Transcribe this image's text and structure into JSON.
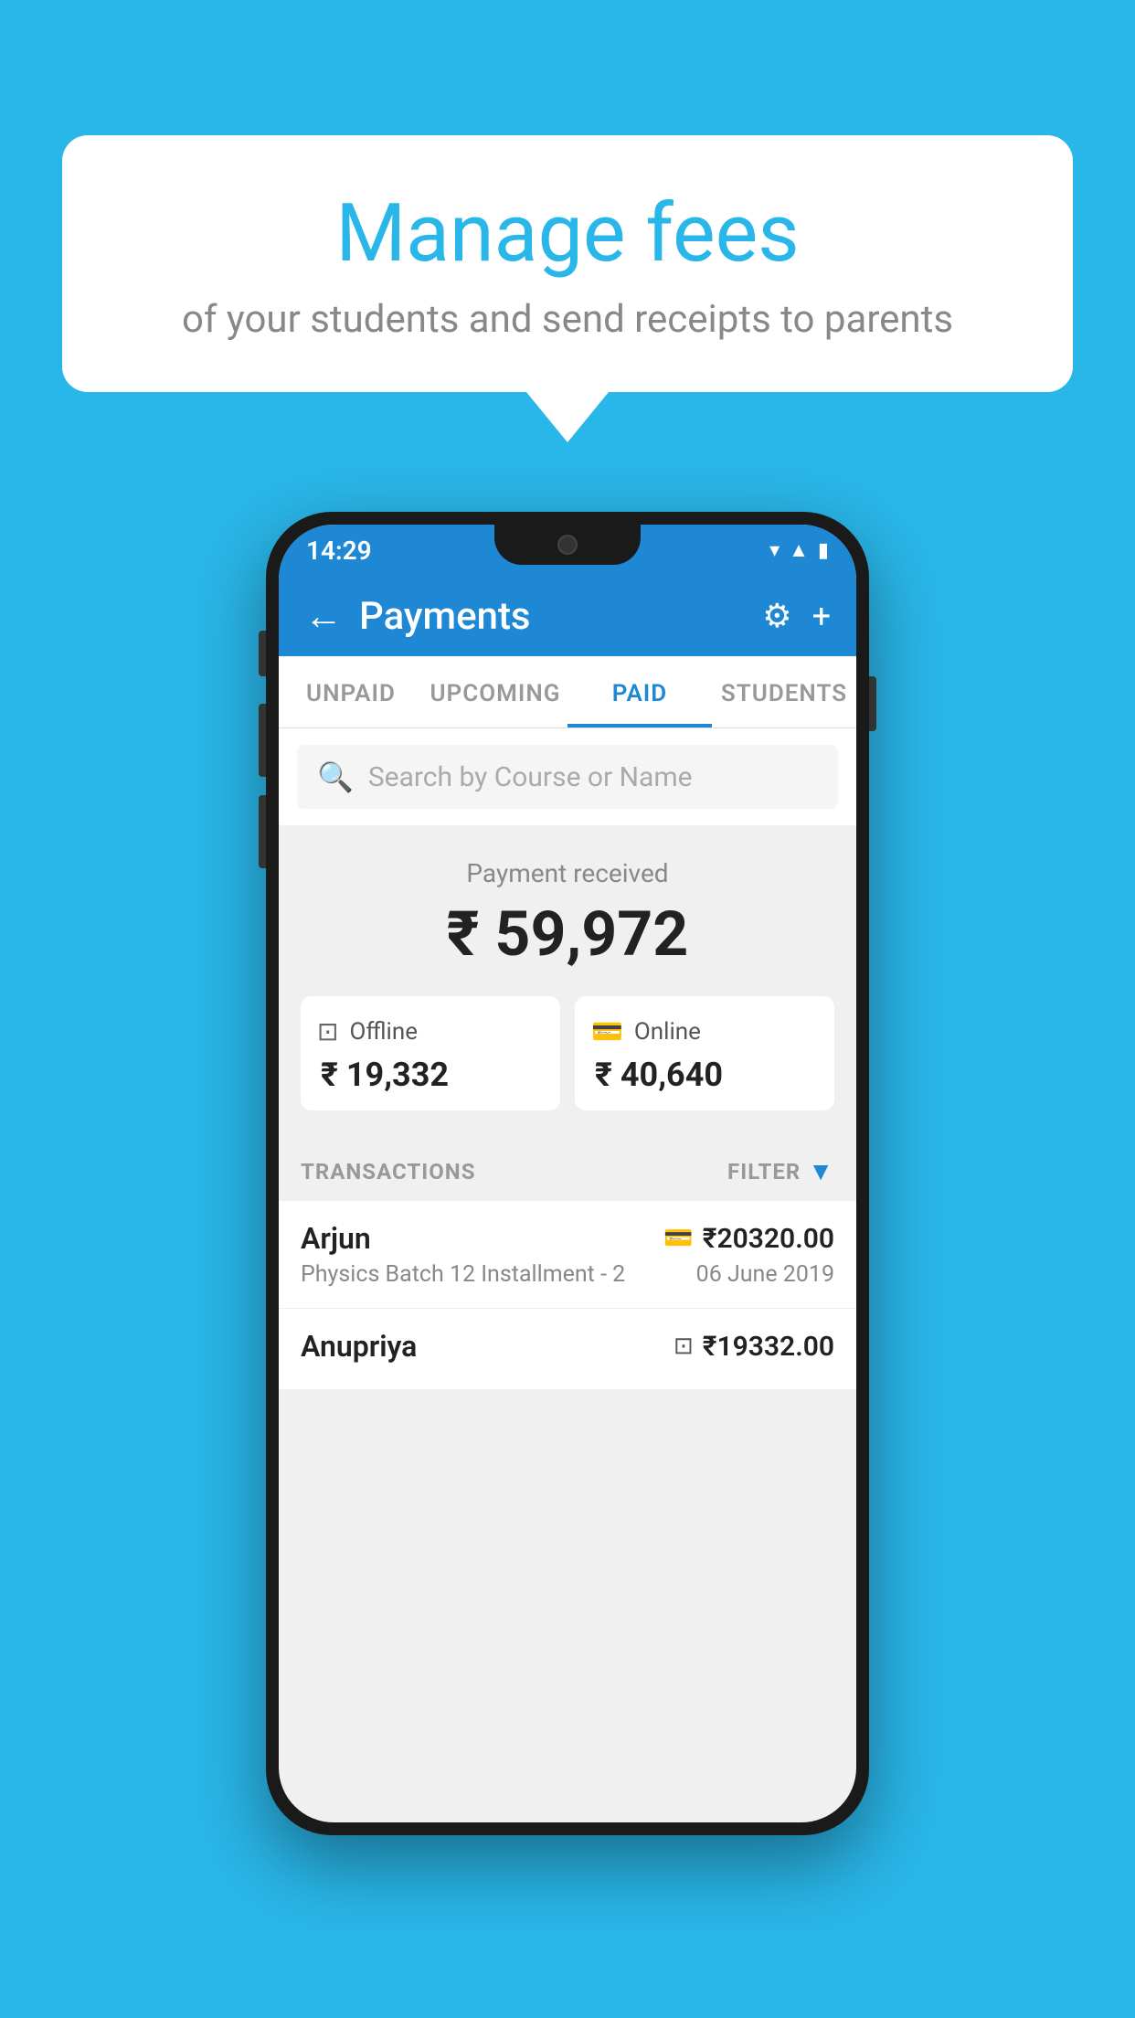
{
  "background_color": "#29b6e8",
  "speech_bubble": {
    "title": "Manage fees",
    "subtitle": "of your students and send receipts to parents"
  },
  "phone": {
    "status_bar": {
      "time": "14:29",
      "icons": [
        "wifi",
        "signal",
        "battery"
      ]
    },
    "app_bar": {
      "back_label": "←",
      "title": "Payments",
      "gear_icon": "⚙",
      "add_icon": "+"
    },
    "tabs": [
      {
        "label": "UNPAID",
        "active": false
      },
      {
        "label": "UPCOMING",
        "active": false
      },
      {
        "label": "PAID",
        "active": true
      },
      {
        "label": "STUDENTS",
        "active": false
      }
    ],
    "search": {
      "placeholder": "Search by Course or Name"
    },
    "payment_summary": {
      "label": "Payment received",
      "total": "₹ 59,972",
      "offline_label": "Offline",
      "offline_amount": "₹ 19,332",
      "online_label": "Online",
      "online_amount": "₹ 40,640"
    },
    "transactions": {
      "section_label": "TRANSACTIONS",
      "filter_label": "FILTER",
      "items": [
        {
          "name": "Arjun",
          "course": "Physics Batch 12 Installment - 2",
          "amount": "₹20320.00",
          "date": "06 June 2019",
          "method": "card"
        },
        {
          "name": "Anupriya",
          "course": "",
          "amount": "₹19332.00",
          "date": "",
          "method": "cash"
        }
      ]
    }
  }
}
